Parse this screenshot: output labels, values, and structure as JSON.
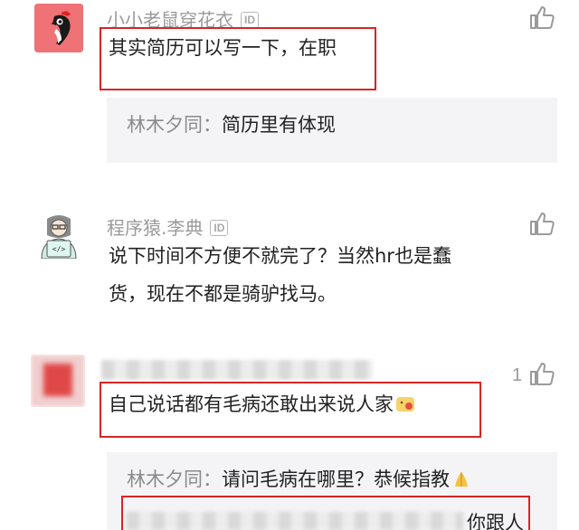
{
  "comments": [
    {
      "username": "小小老鼠穿花衣",
      "id_badge": "ID",
      "text": "其实简历可以写一下，在职",
      "like_icon": "thumbs-up-icon",
      "avatar_icon": "woodpecker-avatar",
      "reply": {
        "author": "林木夕同：",
        "text": "简历里有体现"
      }
    },
    {
      "username": "程序猿.李典",
      "id_badge": "ID",
      "text_line1": "说下时间不方便不就完了？当然hr也是蠢",
      "text_line2": "货，现在不都是骑驴找马。",
      "like_icon": "thumbs-up-icon",
      "avatar_icon": "programmer-avatar",
      "avatar_code": "</>"
    },
    {
      "username": "",
      "id_badge": "",
      "text": "自己说话都有毛病还敢出来说人家",
      "emoji_icon": "face-emoji-icon",
      "like_count": "1",
      "like_icon": "thumbs-up-icon",
      "avatar_icon": "blurred-avatar",
      "reply": {
        "author": "林木夕同：",
        "text": "请问毛病在哪里？恭候指教",
        "emoji_icon": "folded-hands-emoji-icon"
      },
      "partial_reply_text": "你跟人"
    }
  ],
  "colors": {
    "highlight_frame": "#d62525",
    "reply_background": "#f4f4f6",
    "username_gray": "#9a9a9a"
  }
}
